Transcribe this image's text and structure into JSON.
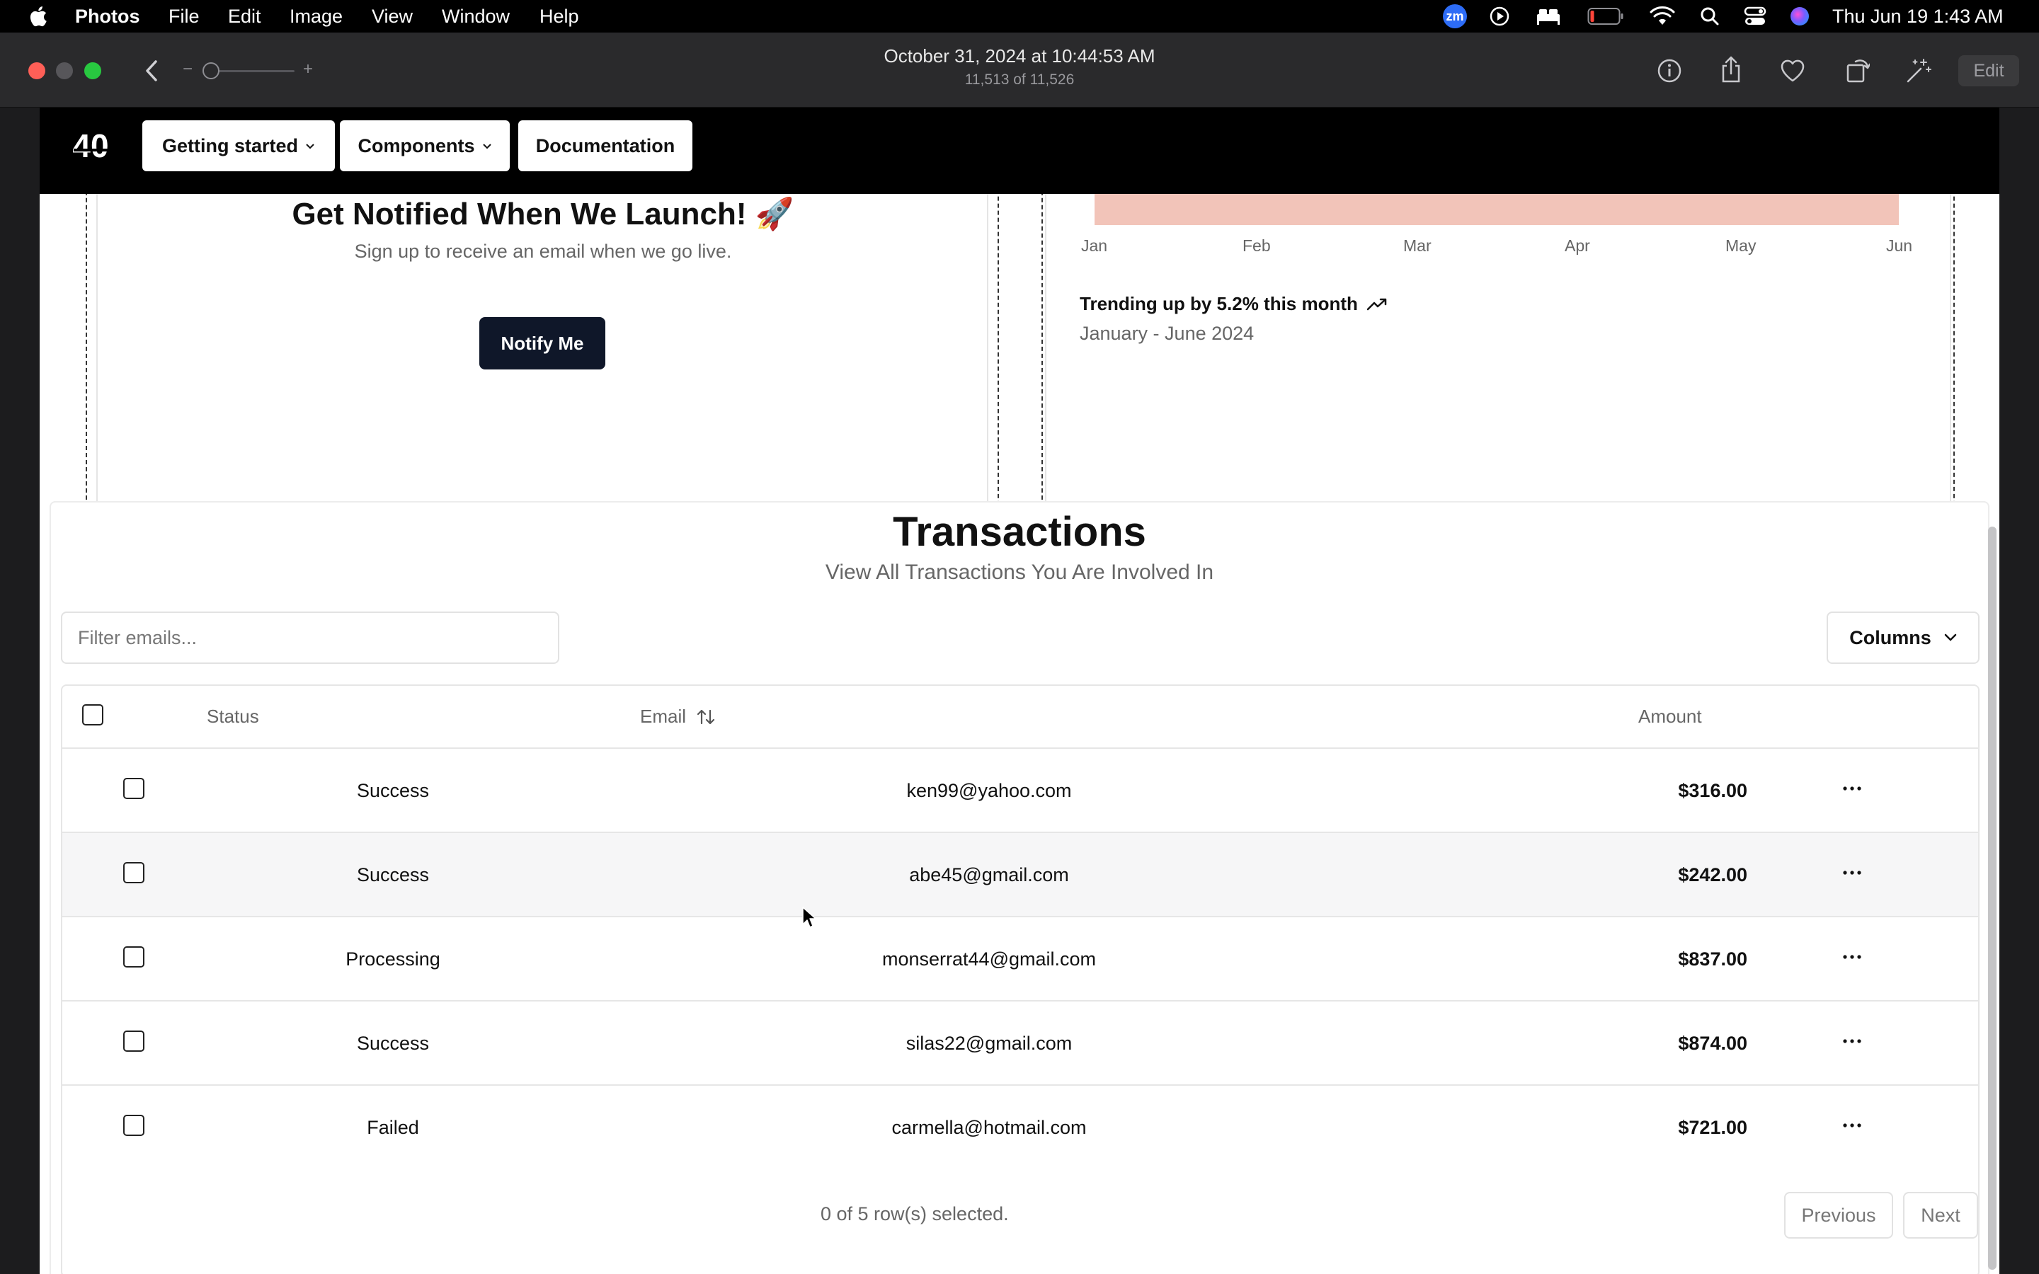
{
  "menubar": {
    "app_name": "Photos",
    "items": [
      "File",
      "Edit",
      "Image",
      "View",
      "Window",
      "Help"
    ],
    "clock": "Thu Jun 19  1:43 AM",
    "zoom_badge": "zm"
  },
  "toolbar": {
    "title": "October 31, 2024 at 10:44:53 AM",
    "subtitle": "11,513 of 11,526",
    "edit_label": "Edit",
    "zoom_minus": "−",
    "zoom_plus": "+"
  },
  "site": {
    "logo_text": "40",
    "nav": [
      {
        "label": "Getting started"
      },
      {
        "label": "Components"
      },
      {
        "label": "Documentation"
      }
    ]
  },
  "notify_card": {
    "title": "Get Notified When We Launch! 🚀",
    "subtitle": "Sign up to receive an email when we go live.",
    "button_label": "Notify Me"
  },
  "chart_card": {
    "months": [
      "Jan",
      "Feb",
      "Mar",
      "Apr",
      "May",
      "Jun"
    ],
    "trend_label": "Trending up by 5.2% this month",
    "range_label": "January - June 2024",
    "bar_color": "#f2c4b9"
  },
  "transactions": {
    "title": "Transactions",
    "subtitle": "View All Transactions You Are Involved In",
    "filter_placeholder": "Filter emails...",
    "columns_label": "Columns",
    "headers": {
      "status": "Status",
      "email": "Email",
      "amount": "Amount"
    },
    "rows": [
      {
        "status": "Success",
        "email": "ken99@yahoo.com",
        "amount": "$316.00"
      },
      {
        "status": "Success",
        "email": "abe45@gmail.com",
        "amount": "$242.00"
      },
      {
        "status": "Processing",
        "email": "monserrat44@gmail.com",
        "amount": "$837.00"
      },
      {
        "status": "Success",
        "email": "silas22@gmail.com",
        "amount": "$874.00"
      },
      {
        "status": "Failed",
        "email": "carmella@hotmail.com",
        "amount": "$721.00"
      }
    ],
    "selection_text": "0 of 5 row(s) selected.",
    "previous_label": "Previous",
    "next_label": "Next"
  }
}
